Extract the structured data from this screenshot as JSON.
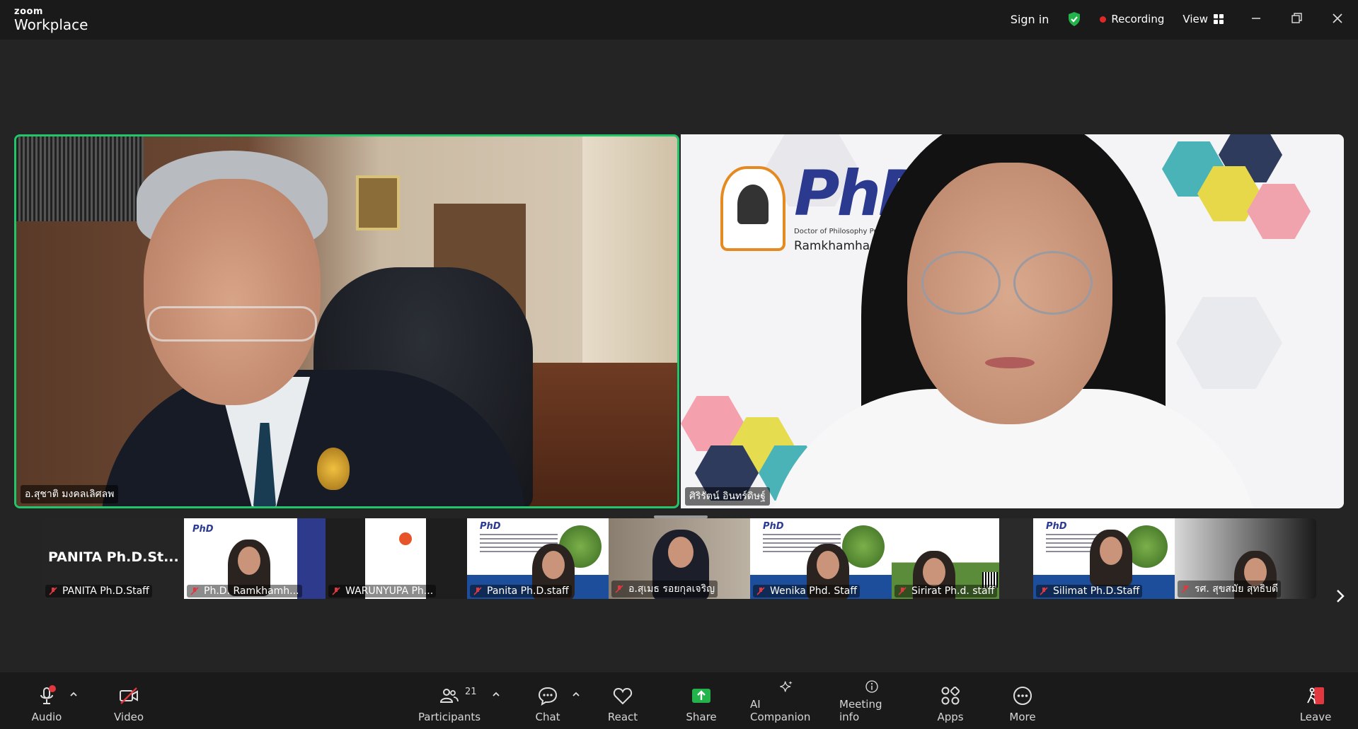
{
  "titlebar": {
    "brand_small": "zoom",
    "brand_large": "Workplace",
    "sign_in": "Sign in",
    "recording": "Recording",
    "view": "View"
  },
  "main_videos": [
    {
      "name": "อ.สุชาติ มงคลเลิศลพ"
    },
    {
      "name": "ศิริรัตน์ อินทร์ดิษฐ์"
    }
  ],
  "branding": {
    "phd": "PhD",
    "program": "Doctor of Philosophy Program in Soc",
    "university": "Ramkhamhaeng Uni"
  },
  "gallery": [
    {
      "label": "PANITA Ph.D.Staff",
      "big_name": "PANITA  Ph.D.St..."
    },
    {
      "label": "Ph.D. Ramkhamh..."
    },
    {
      "label": "WARUNYUPA Ph..."
    },
    {
      "label": "Panita Ph.D.staff"
    },
    {
      "label": "อ.สุเมธ รอยกุลเจริญ"
    },
    {
      "label": "Wenika Phd. Staff"
    },
    {
      "label": "Sirirat Ph.d. staff"
    },
    {
      "label": "Silimat Ph.D.Staff"
    },
    {
      "label": "รศ. สุขสมัย สุทธิบดี"
    }
  ],
  "toolbar": {
    "audio": "Audio",
    "video": "Video",
    "participants": "Participants",
    "participants_count": "21",
    "chat": "Chat",
    "react": "React",
    "share": "Share",
    "ai_companion": "AI Companion",
    "meeting_info": "Meeting info",
    "apps": "Apps",
    "more": "More",
    "leave": "Leave"
  },
  "colors": {
    "active_speaker_border": "#22c56a",
    "share_green": "#22b34a",
    "recording_red": "#e02828",
    "leave_red": "#e0383e",
    "phd_blue": "#2b3a8f",
    "phd_orange": "#e58a20"
  }
}
